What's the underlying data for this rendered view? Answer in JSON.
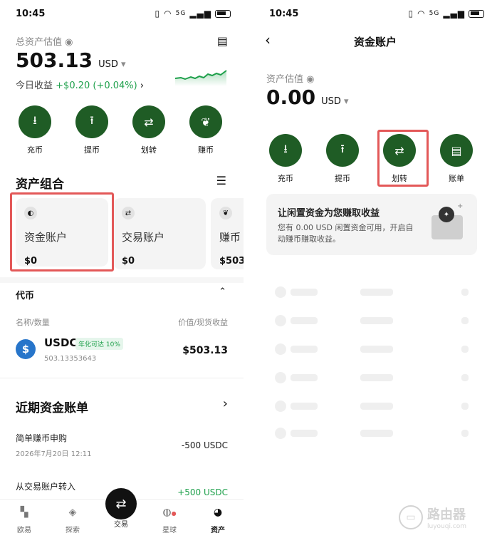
{
  "status": {
    "time": "10:45",
    "net": "5G"
  },
  "left": {
    "total_label": "总资产估值",
    "total_value": "503.13",
    "currency": "USD",
    "today_label": "今日收益",
    "today_value": "+$0.20 (+0.04%)",
    "actions": [
      {
        "label": "充币",
        "icon": "deposit-icon"
      },
      {
        "label": "提币",
        "icon": "withdraw-icon"
      },
      {
        "label": "划转",
        "icon": "transfer-icon"
      },
      {
        "label": "赚币",
        "icon": "earn-icon"
      }
    ],
    "portfolio_title": "资产组合",
    "accounts": [
      {
        "name": "资金账户",
        "amount": "$0"
      },
      {
        "name": "交易账户",
        "amount": "$0"
      },
      {
        "name": "赚币",
        "amount": "$503."
      }
    ],
    "token_section": "代币",
    "col_left": "名称/数量",
    "col_right": "价值/现货收益",
    "token": {
      "symbol": "USDC",
      "badge": "年化可达 10%",
      "qty": "503.13353643",
      "value": "$503.13"
    },
    "recent_title": "近期资金账单",
    "bills": [
      {
        "title": "简单赚币申购",
        "time": "2026年7月20日 12:11",
        "amount": "-500 USDC"
      },
      {
        "title": "从交易账户转入",
        "amount": "+500 USDC"
      }
    ],
    "tabs": [
      "欧易",
      "探索",
      "交易",
      "星球",
      "资产"
    ]
  },
  "right": {
    "page_title": "资金账户",
    "est_label": "资产估值",
    "est_value": "0.00",
    "currency": "USD",
    "actions": [
      {
        "label": "充币",
        "icon": "deposit-icon"
      },
      {
        "label": "提币",
        "icon": "withdraw-icon"
      },
      {
        "label": "划转",
        "icon": "transfer-icon"
      },
      {
        "label": "账单",
        "icon": "bill-icon"
      }
    ],
    "promo_title": "让闲置资金为您赚取收益",
    "promo_body": "您有 0.00 USD 闲置资金可用，开启自动赚币赚取收益。"
  },
  "watermark": {
    "name": "路由器",
    "url": "luyouqi.com"
  },
  "colors": {
    "accent": "#1f5c25",
    "positive": "#1ea04b",
    "highlight": "#e35858"
  }
}
